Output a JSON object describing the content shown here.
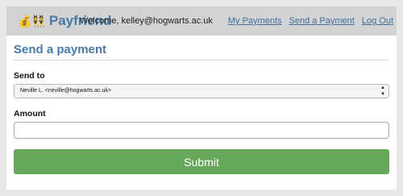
{
  "brand": {
    "icon": "💰👯",
    "name": "Payfriend"
  },
  "nav": {
    "welcome": "Welcome, kelley@hogwarts.ac.uk",
    "links": [
      "My Payments",
      "Send a Payment",
      "Log Out"
    ]
  },
  "form": {
    "heading": "Send a payment",
    "send_to_label": "Send to",
    "send_to_value": "Neville L. <neville@hogwarts.ac.uk>",
    "amount_label": "Amount",
    "amount_value": "",
    "submit_label": "Submit"
  },
  "colors": {
    "brand": "#4a7aa8",
    "submit": "#67a75c",
    "navbar": "#d3d3d3"
  }
}
